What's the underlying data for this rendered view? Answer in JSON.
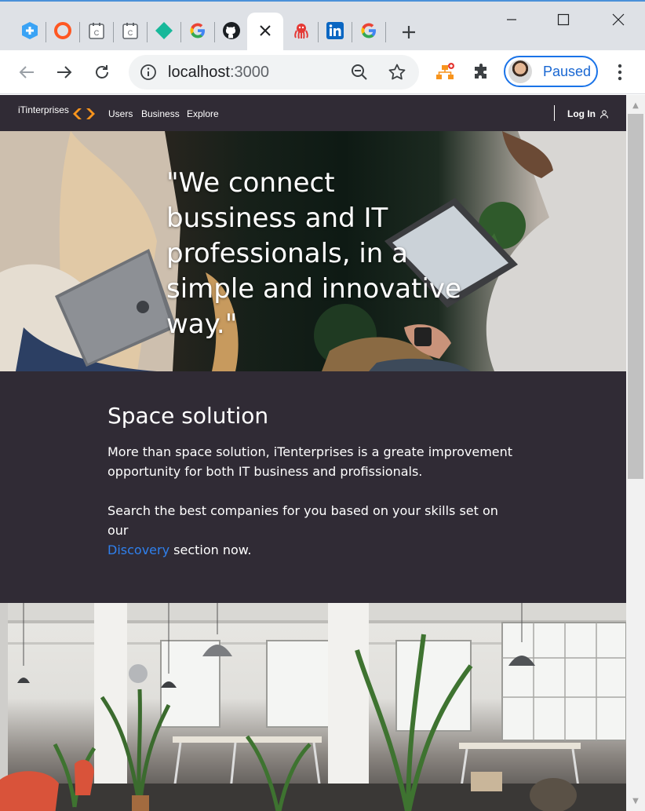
{
  "browser": {
    "tabs": [
      {
        "icon": "plus-shield-icon"
      },
      {
        "icon": "ring-icon"
      },
      {
        "icon": "page-c-icon"
      },
      {
        "icon": "page-c-icon"
      },
      {
        "icon": "diamond-icon"
      },
      {
        "icon": "google-icon"
      },
      {
        "icon": "github-icon"
      },
      {
        "icon": "close-icon",
        "active": true
      },
      {
        "icon": "octopus-icon"
      },
      {
        "icon": "linkedin-icon"
      },
      {
        "icon": "google-icon"
      }
    ],
    "address": {
      "host": "localhost",
      "port": ":3000"
    },
    "profile_label": "Paused"
  },
  "site": {
    "logo_text": "iTinterprises",
    "nav": {
      "users": "Users",
      "business": "Business",
      "explore": "Explore",
      "login": "Log In"
    },
    "hero": {
      "quote": "\"We connect bussiness and IT professionals, in a simple and innovative way.\""
    },
    "info": {
      "title": "Space solution",
      "paragraph1": "More than space solution, iTenterprises is a greate improvement opportunity for both IT business and profissionals.",
      "paragraph2_before": "Search the best companies for you based on your skills set on our",
      "paragraph2_link": "Discovery",
      "paragraph2_after": " section now."
    }
  },
  "colors": {
    "accent": "#f7941d",
    "link": "#2f80ed",
    "dark_bg": "#302b35"
  }
}
